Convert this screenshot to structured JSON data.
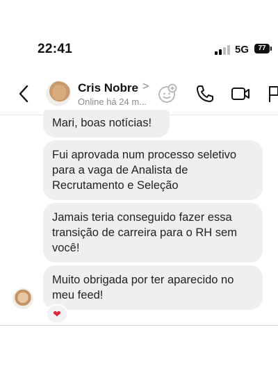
{
  "status_bar": {
    "time": "22:41",
    "network": "5G",
    "battery": "77"
  },
  "header": {
    "contact_name": "Cris Nobre",
    "name_chevron": ">",
    "presence": "Online há 24 m..."
  },
  "messages": [
    {
      "text": "Mari, boas notícias!"
    },
    {
      "text": "Fui aprovada num processo seletivo para a vaga de Analista de Recrutamento e Seleção"
    },
    {
      "text": "Jamais teria conseguido fazer essa transição de carreira para o RH sem você!"
    },
    {
      "text": "Muito obrigada por ter aparecido no meu feed!"
    }
  ],
  "reaction": "❤",
  "icons": {
    "back": "chevron-left-icon",
    "effects": "sticker-plus-icon",
    "call": "phone-icon",
    "video": "video-camera-icon",
    "flag": "flag-icon"
  },
  "colors": {
    "bubble": "#efeff1",
    "heart": "#e0283c"
  }
}
